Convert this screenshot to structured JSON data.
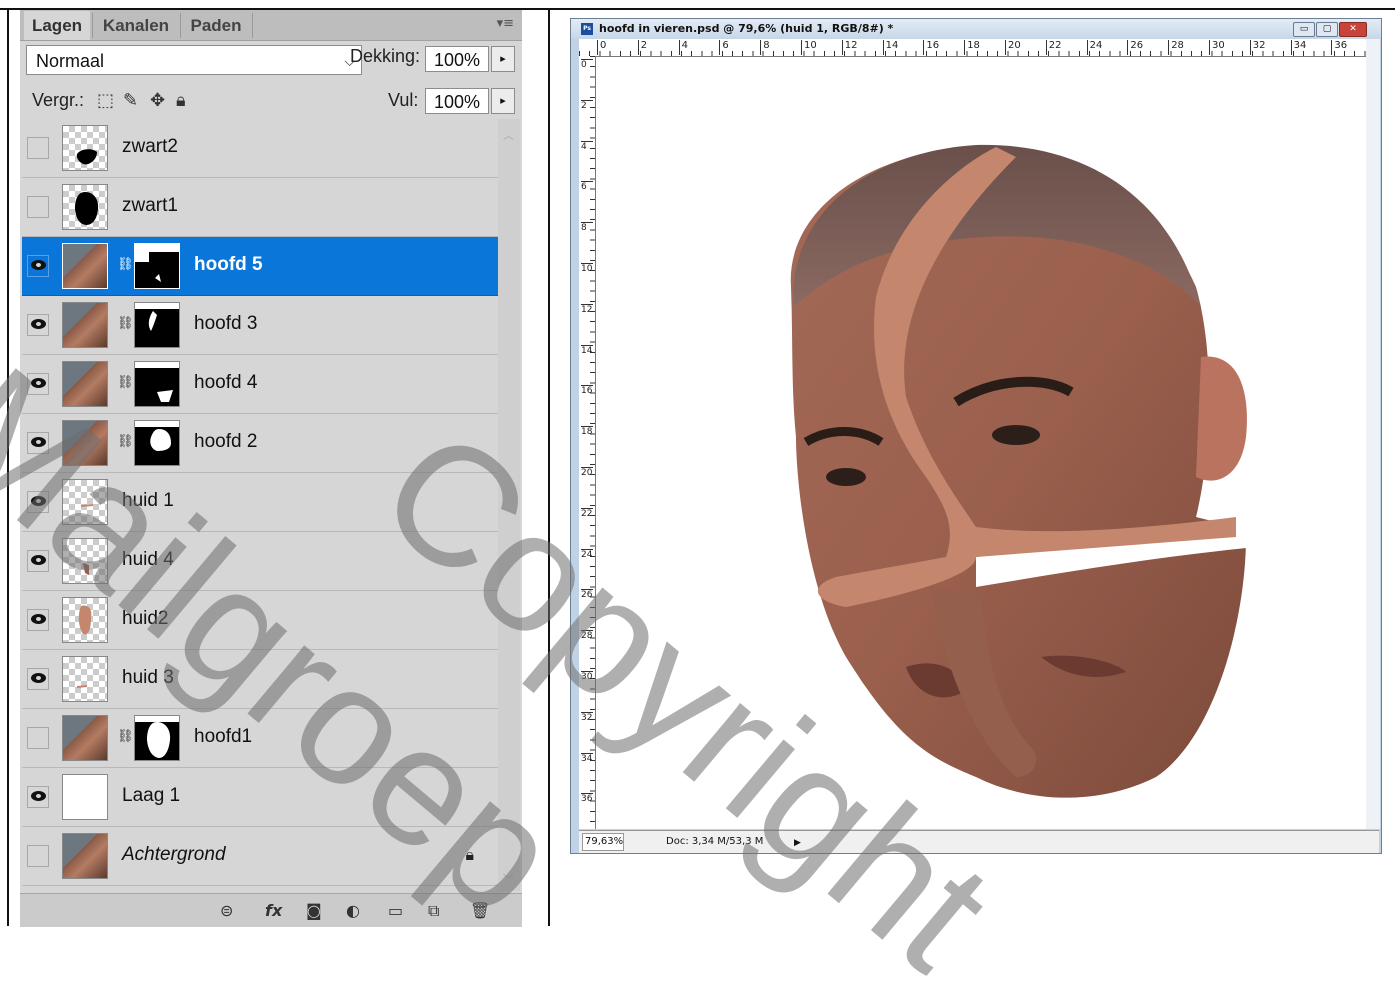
{
  "layers_panel": {
    "tabs": [
      {
        "label": "Lagen",
        "active": true
      },
      {
        "label": "Kanalen",
        "active": false
      },
      {
        "label": "Paden",
        "active": false
      }
    ],
    "blend_mode": "Normaal",
    "opacity_label": "Dekking:",
    "opacity_value": "100%",
    "lock_label": "Vergr.:",
    "fill_label": "Vul:",
    "fill_value": "100%",
    "layers": [
      {
        "name": "zwart2",
        "visible": false,
        "selected": false,
        "has_mask": false
      },
      {
        "name": "zwart1",
        "visible": false,
        "selected": false,
        "has_mask": false
      },
      {
        "name": "hoofd 5",
        "visible": true,
        "selected": true,
        "has_mask": true
      },
      {
        "name": "hoofd 3",
        "visible": true,
        "selected": false,
        "has_mask": true
      },
      {
        "name": "hoofd 4",
        "visible": true,
        "selected": false,
        "has_mask": true
      },
      {
        "name": "hoofd 2",
        "visible": true,
        "selected": false,
        "has_mask": true
      },
      {
        "name": "huid 1",
        "visible": true,
        "selected": false,
        "has_mask": false
      },
      {
        "name": "huid 4",
        "visible": true,
        "selected": false,
        "has_mask": false
      },
      {
        "name": "huid2",
        "visible": true,
        "selected": false,
        "has_mask": false
      },
      {
        "name": "huid 3",
        "visible": true,
        "selected": false,
        "has_mask": false
      },
      {
        "name": "hoofd1",
        "visible": false,
        "selected": false,
        "has_mask": true
      },
      {
        "name": "Laag 1",
        "visible": true,
        "selected": false,
        "has_mask": false
      },
      {
        "name": "Achtergrond",
        "visible": false,
        "selected": false,
        "has_mask": false,
        "locked": true,
        "italic": true
      }
    ],
    "footer_icons": [
      "link-icon",
      "fx-icon",
      "mask-icon",
      "adjustment-icon",
      "folder-icon",
      "new-layer-icon",
      "trash-icon"
    ]
  },
  "document": {
    "title": "hoofd in vieren.psd @ 79,6% (huid 1, RGB/8#) *",
    "ruler_h": [
      "0",
      "2",
      "4",
      "6",
      "8",
      "10",
      "12",
      "14",
      "16",
      "18",
      "20",
      "22",
      "24",
      "26",
      "28",
      "30",
      "32",
      "34",
      "36"
    ],
    "ruler_v": [
      "0",
      "2",
      "4",
      "6",
      "8",
      "10",
      "12",
      "14",
      "16",
      "18",
      "20",
      "22",
      "24",
      "26",
      "28",
      "30",
      "32",
      "34",
      "36"
    ],
    "status_zoom": "79,63%",
    "status_doc": "Doc: 3,34 M/53,3 M"
  },
  "watermark": {
    "text1": "Mailgroep",
    "text2": "Copyright"
  },
  "colors": {
    "selection": "#0a76d9",
    "panel_bg": "#d6d6d6",
    "skin_light": "#c4876d",
    "skin_dark": "#94604d"
  }
}
